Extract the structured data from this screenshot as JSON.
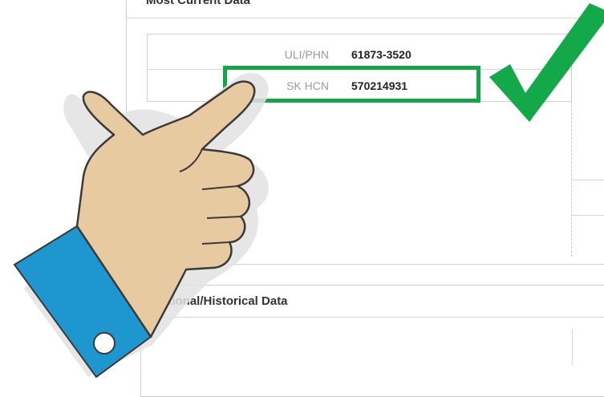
{
  "sections": {
    "current_title": "Most Current Data",
    "historical_title": "Additional/Historical Data",
    "historical_visible_fragment": "ional/Historical Data"
  },
  "identifiers": [
    {
      "label": "ULI/PHN",
      "value": "61873-3520"
    },
    {
      "label": "SK HCN",
      "value": "570214931"
    }
  ],
  "colors": {
    "highlight": "#14a54a",
    "checkmark": "#13a84a",
    "hand_skin": "#e8caa0",
    "hand_outline": "#3a3a3a",
    "cuff": "#1e97d1"
  },
  "icons": {
    "checkmark": "check-icon",
    "pointer": "pointing-hand-icon"
  }
}
